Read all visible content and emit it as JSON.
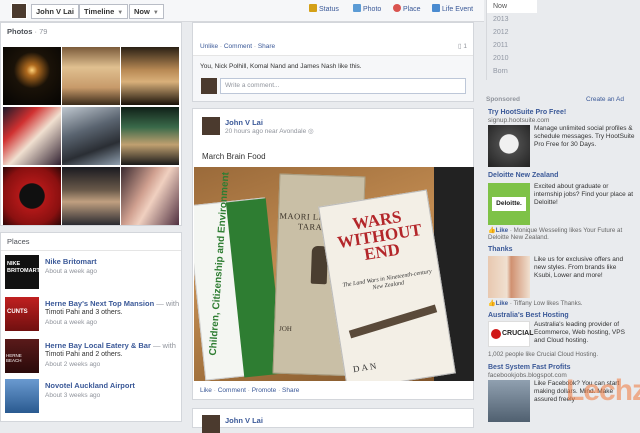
{
  "topbar": {
    "name_label": "John V Lai",
    "timeline_label": "Timeline",
    "now_label": "Now",
    "composer": [
      {
        "label": "Status",
        "icon": "status-icon",
        "color": "#d4a017"
      },
      {
        "label": "Photo",
        "icon": "photo-icon",
        "color": "#5b9bd5"
      },
      {
        "label": "Place",
        "icon": "place-icon",
        "color": "#d9534f"
      },
      {
        "label": "Life Event",
        "icon": "flag-icon",
        "color": "#4a8bd0"
      }
    ]
  },
  "scrubber": {
    "items": [
      "Now",
      "2013",
      "2012",
      "2011",
      "2010",
      "Born"
    ]
  },
  "photos": {
    "title": "Photos",
    "count": "· 79"
  },
  "places": {
    "title": "Places",
    "items": [
      {
        "title": "Nike Britomart",
        "with": "",
        "sub": "",
        "time": "About a week ago",
        "thumb_text": "NIKE BRITOMART"
      },
      {
        "title": "Herne Bay's Next Top Mansion",
        "with": " — with",
        "sub": "Timoti Pahi and 3 others.",
        "time": "About a week ago",
        "thumb_text": "CUNTS"
      },
      {
        "title": "Herne Bay Local Eatery & Bar",
        "with": " — with",
        "sub": "Timoti Pahi and 2 others.",
        "time": "About 2 weeks ago",
        "thumb_text": "HERNE BEACH"
      },
      {
        "title": "Novotel Auckland Airport",
        "with": "",
        "sub": "",
        "time": "About 3 weeks ago",
        "thumb_text": ""
      }
    ]
  },
  "post1": {
    "actions": [
      "Unlike",
      "Comment",
      "Share"
    ],
    "comment_count": "1",
    "likes": "You, Nick Polhill, Komal Nand and James Nash like this.",
    "comment_placeholder": "Write a comment..."
  },
  "post2": {
    "author": "John V Lai",
    "meta": "20 hours ago near Avondale",
    "text": "March Brain Food",
    "actions": [
      "Like",
      "Comment",
      "Promote",
      "Share"
    ],
    "books": {
      "green_title": "Children, Citizenship and Environment",
      "maori_title": "MAORI LIFE in OLD TARANAKI",
      "maori_author": "JOH",
      "wars_title": "WARS WITHOUT END",
      "wars_sub": "The Land Wars in Nineteenth-century New Zealand",
      "wars_author": "DAN"
    }
  },
  "post3": {
    "author": "John V Lai"
  },
  "sponsored": {
    "label": "Sponsored",
    "create": "Create an Ad",
    "ads": [
      {
        "title": "Try HootSuite Pro Free!",
        "url": "signup.hootsuite.com",
        "text": "Manage unlimited social profiles & schedule messages. Try HootSuite Pro Free for 30 Days.",
        "like": ""
      },
      {
        "title": "Deloitte New Zealand",
        "url": "",
        "text": "Excited about graduate or internship jobs? Find your place at Deloitte!",
        "like_link": "Like",
        "like": " · Monique Wesseling likes Your Future at Deloitte New Zealand.",
        "brand": "Deloitte."
      },
      {
        "title": "Thanks",
        "url": "",
        "text": "Like us for exclusive offers and new styles. From brands like Ksubi, Lower and more!",
        "like_link": "Like",
        "like": " · Tiffany Low likes Thanks."
      },
      {
        "title": "Australia's Best Hosting",
        "url": "",
        "text": "Australia's leading provider of Ecommerce, Web hosting, VPS and Cloud hosting.",
        "like": "1,002 people like Crucial Cloud Hosting.",
        "brand": "CRUCIAL"
      },
      {
        "title": "Best System Fast Profits",
        "url": "facebookjobs.blogspot.com",
        "text": "Like Facebook? You can start making dollars. Mind. Make assured freely",
        "like": "",
        "brand": ""
      }
    ]
  },
  "watermark": "Lechz",
  "colors": {
    "fb_blue": "#3b5998",
    "bg": "#e9ebee"
  }
}
